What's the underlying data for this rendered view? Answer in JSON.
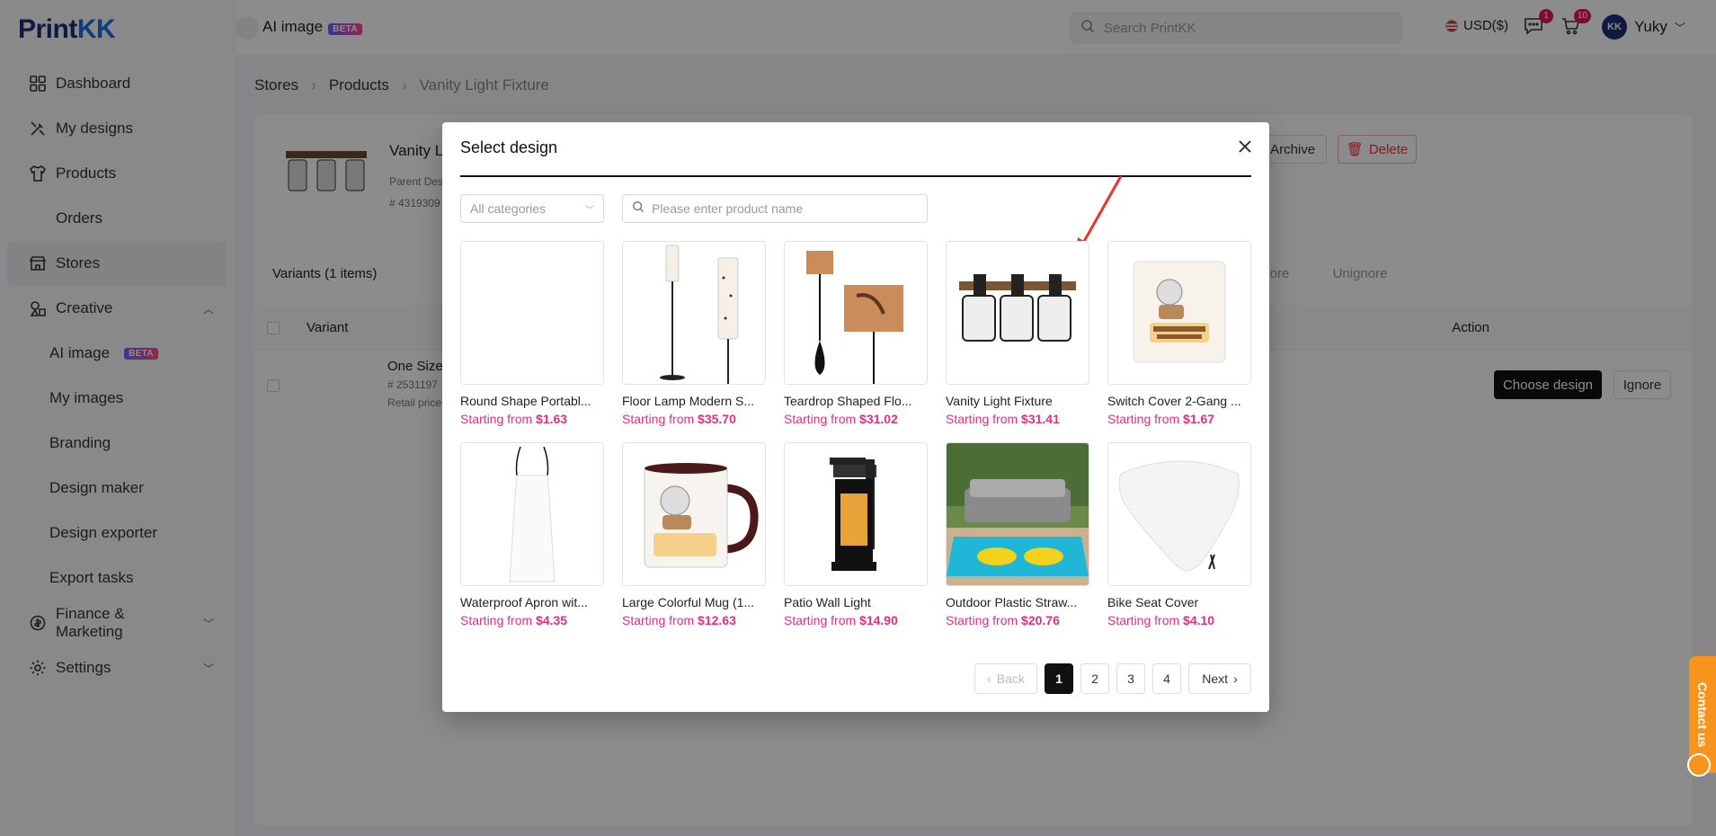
{
  "app": {
    "logo_print": "Print",
    "logo_kk": "KK",
    "page_title": "AI image",
    "beta": "BETA",
    "search_placeholder": "Search PrintKK",
    "currency": "USD($)",
    "messages_count": "1",
    "cart_count": "10",
    "user_name": "Yuky",
    "user_initials": "KK"
  },
  "sidebar": {
    "items": [
      {
        "label": "Dashboard",
        "icon": "grid-icon"
      },
      {
        "label": "My designs",
        "icon": "palette-icon"
      },
      {
        "label": "Products",
        "icon": "shirt-icon"
      },
      {
        "label": "Orders",
        "icon": "orders-icon"
      },
      {
        "label": "Stores",
        "icon": "store-icon"
      },
      {
        "label": "Creative",
        "icon": "creative-icon"
      },
      {
        "label": "AI image",
        "icon": ""
      },
      {
        "label": "My images",
        "icon": ""
      },
      {
        "label": "Branding",
        "icon": ""
      },
      {
        "label": "Design maker",
        "icon": ""
      },
      {
        "label": "Design exporter",
        "icon": ""
      },
      {
        "label": "Export tasks",
        "icon": ""
      },
      {
        "label": "Finance & Marketing",
        "icon": "finance-icon"
      },
      {
        "label": "Settings",
        "icon": "gear-icon"
      }
    ]
  },
  "breadcrumb": {
    "a": "Stores",
    "b": "Products",
    "c": "Vanity Light Fixture"
  },
  "product": {
    "name": "Vanity L",
    "parent": "Parent Des",
    "id": "# 4319309",
    "archive": "Archive",
    "delete": "Delete"
  },
  "variants": {
    "title": "Variants (1 items)",
    "ignore": "Ignore",
    "unignore": "Unignore",
    "col_variant": "Variant",
    "col_action": "Action",
    "row_name": "One Size",
    "row_id": "# 2531197",
    "row_retail": "Retail price",
    "choose_design": "Choose design",
    "row_ignore": "Ignore"
  },
  "contact": "Contact us",
  "modal": {
    "title": "Select design",
    "category_placeholder": "All categories",
    "search_placeholder": "Please enter product name",
    "price_prefix": "Starting from",
    "products": [
      {
        "name": "Round Shape Portabl...",
        "price": "$1.63",
        "img": "blank"
      },
      {
        "name": "Floor Lamp Modern S...",
        "price": "$35.70",
        "img": "floor-lamp"
      },
      {
        "name": "Teardrop Shaped Flo...",
        "price": "$31.02",
        "img": "teardrop-lamp"
      },
      {
        "name": "Vanity Light Fixture",
        "price": "$31.41",
        "img": "vanity-light"
      },
      {
        "name": "Switch Cover 2-Gang ...",
        "price": "$1.67",
        "img": "switch-cover"
      },
      {
        "name": "Waterproof Apron wit...",
        "price": "$4.35",
        "img": "apron"
      },
      {
        "name": "Large Colorful Mug (1...",
        "price": "$12.63",
        "img": "mug"
      },
      {
        "name": "Patio Wall Light",
        "price": "$14.90",
        "img": "wall-light"
      },
      {
        "name": "Outdoor Plastic Straw...",
        "price": "$20.76",
        "img": "outdoor-mat"
      },
      {
        "name": "Bike Seat Cover",
        "price": "$4.10",
        "img": "seat-cover"
      }
    ],
    "pagination": {
      "back": "Back",
      "pages": [
        "1",
        "2",
        "3",
        "4"
      ],
      "next": "Next",
      "current": "1"
    }
  },
  "colors": {
    "accent": "#e0307a",
    "primary": "#111111",
    "brand": "#1f2f77"
  }
}
